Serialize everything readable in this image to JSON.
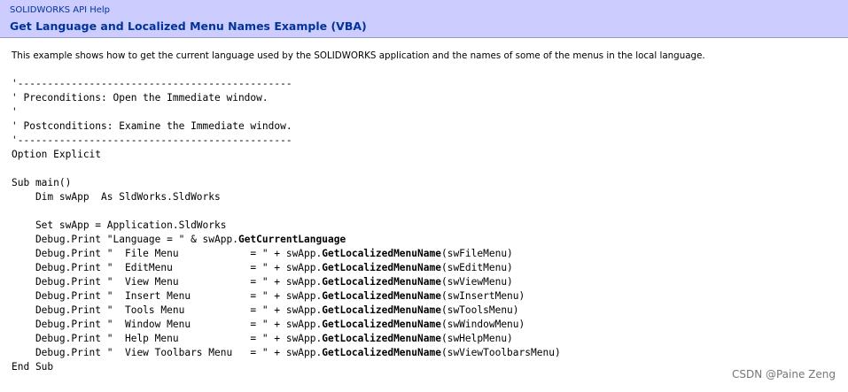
{
  "header": {
    "breadcrumb": "SOLIDWORKS API Help",
    "title": "Get Language and Localized Menu Names Example (VBA)",
    "background_color": "#ccccff",
    "title_color": "#003399"
  },
  "description": "This example shows how to get the current language used by the SOLIDWORKS application and the names of some of the menus in the local language.",
  "code_lines": [
    [
      {
        "t": "'----------------------------------------------"
      }
    ],
    [
      {
        "t": "' Preconditions: Open the Immediate window."
      }
    ],
    [
      {
        "t": "'"
      }
    ],
    [
      {
        "t": "' Postconditions: Examine the Immediate window."
      }
    ],
    [
      {
        "t": "'----------------------------------------------"
      }
    ],
    [
      {
        "t": "Option Explicit"
      }
    ],
    [
      {
        "t": ""
      }
    ],
    [
      {
        "t": "Sub main()"
      }
    ],
    [
      {
        "t": "    Dim swApp  As SldWorks.SldWorks"
      }
    ],
    [
      {
        "t": ""
      }
    ],
    [
      {
        "t": "    Set swApp = Application.SldWorks"
      }
    ],
    [
      {
        "t": "    Debug.Print \"Language = \" & swApp."
      },
      {
        "t": "GetCurrentLanguage",
        "b": true
      }
    ],
    [
      {
        "t": "    Debug.Print \"  File Menu            = \" + swApp."
      },
      {
        "t": "GetLocalizedMenuName",
        "b": true
      },
      {
        "t": "(swFileMenu)"
      }
    ],
    [
      {
        "t": "    Debug.Print \"  EditMenu             = \" + swApp."
      },
      {
        "t": "GetLocalizedMenuName",
        "b": true
      },
      {
        "t": "(swEditMenu)"
      }
    ],
    [
      {
        "t": "    Debug.Print \"  View Menu            = \" + swApp."
      },
      {
        "t": "GetLocalizedMenuName",
        "b": true
      },
      {
        "t": "(swViewMenu)"
      }
    ],
    [
      {
        "t": "    Debug.Print \"  Insert Menu          = \" + swApp."
      },
      {
        "t": "GetLocalizedMenuName",
        "b": true
      },
      {
        "t": "(swInsertMenu)"
      }
    ],
    [
      {
        "t": "    Debug.Print \"  Tools Menu           = \" + swApp."
      },
      {
        "t": "GetLocalizedMenuName",
        "b": true
      },
      {
        "t": "(swToolsMenu)"
      }
    ],
    [
      {
        "t": "    Debug.Print \"  Window Menu          = \" + swApp."
      },
      {
        "t": "GetLocalizedMenuName",
        "b": true
      },
      {
        "t": "(swWindowMenu)"
      }
    ],
    [
      {
        "t": "    Debug.Print \"  Help Menu            = \" + swApp."
      },
      {
        "t": "GetLocalizedMenuName",
        "b": true
      },
      {
        "t": "(swHelpMenu)"
      }
    ],
    [
      {
        "t": "    Debug.Print \"  View Toolbars Menu   = \" + swApp."
      },
      {
        "t": "GetLocalizedMenuName",
        "b": true
      },
      {
        "t": "(swViewToolbarsMenu)"
      }
    ],
    [
      {
        "t": "End Sub"
      }
    ]
  ],
  "watermark": "CSDN @Paine Zeng"
}
